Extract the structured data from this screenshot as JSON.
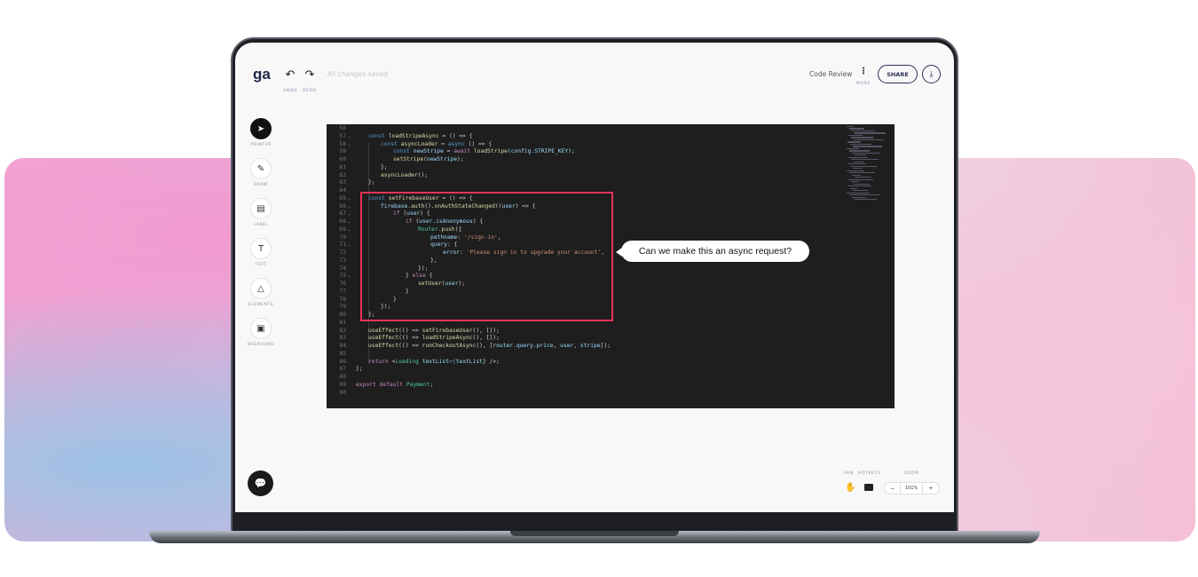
{
  "app": {
    "logo": "ga",
    "undo": "UNDO",
    "redo": "REDO",
    "status": "All changes saved",
    "doc_title": "Code Review",
    "more": "MORE",
    "share": "SHARE"
  },
  "tools": [
    {
      "label": "POINTER",
      "icon": "➤"
    },
    {
      "label": "DRAW",
      "icon": "✎"
    },
    {
      "label": "LABEL",
      "icon": "▤"
    },
    {
      "label": "TEXT",
      "icon": "T"
    },
    {
      "label": "ELEMENTS",
      "icon": "△"
    },
    {
      "label": "BKGROUND",
      "icon": "▣"
    }
  ],
  "bottom": {
    "pan": "PAN",
    "hotkeys": "HOTKEYS",
    "zoom_label": "ZOOM",
    "zoom_value": "101%",
    "minus": "−",
    "plus": "+"
  },
  "comment": "Can we make this an async request?",
  "colors": {
    "highlight": "#e8335a",
    "editor_bg": "#1e1e1e"
  },
  "code": [
    {
      "n": "56",
      "i": 0,
      "f": false,
      "t": []
    },
    {
      "n": "57",
      "i": 1,
      "f": true,
      "t": [
        [
          "const ",
          "k"
        ],
        [
          "loadStripeAsync",
          "fn"
        ],
        [
          " = () => {",
          "d"
        ]
      ]
    },
    {
      "n": "58",
      "i": 2,
      "f": true,
      "t": [
        [
          "const ",
          "k"
        ],
        [
          "asyncLoader",
          "fn"
        ],
        [
          " = ",
          "d"
        ],
        [
          "async",
          "k"
        ],
        [
          " () => {",
          "d"
        ]
      ]
    },
    {
      "n": "59",
      "i": 3,
      "f": false,
      "t": [
        [
          "const ",
          "k"
        ],
        [
          "newStripe",
          "v"
        ],
        [
          " = ",
          "d"
        ],
        [
          "await ",
          "p"
        ],
        [
          "loadStripe",
          "fn"
        ],
        [
          "(config.STRIPE_KEY);",
          "v"
        ]
      ]
    },
    {
      "n": "60",
      "i": 3,
      "f": false,
      "t": [
        [
          "setStripe",
          "fn"
        ],
        [
          "(",
          "d"
        ],
        [
          "newStripe",
          "v"
        ],
        [
          ");",
          "d"
        ]
      ]
    },
    {
      "n": "61",
      "i": 2,
      "f": false,
      "t": [
        [
          "};",
          "d"
        ]
      ]
    },
    {
      "n": "62",
      "i": 2,
      "f": false,
      "t": [
        [
          "asyncLoader",
          "fn"
        ],
        [
          "();",
          "d"
        ]
      ]
    },
    {
      "n": "63",
      "i": 1,
      "f": false,
      "t": [
        [
          "};",
          "d"
        ]
      ]
    },
    {
      "n": "64",
      "i": 0,
      "f": false,
      "t": []
    },
    {
      "n": "65",
      "i": 1,
      "f": true,
      "t": [
        [
          "const ",
          "k"
        ],
        [
          "setFirebaseUser",
          "fn"
        ],
        [
          " = () => {",
          "d"
        ]
      ]
    },
    {
      "n": "66",
      "i": 2,
      "f": true,
      "t": [
        [
          "firebase",
          "v"
        ],
        [
          ".",
          "d"
        ],
        [
          "auth",
          "fn"
        ],
        [
          "().",
          "d"
        ],
        [
          "onAuthStateChanged",
          "fn"
        ],
        [
          "((",
          "d"
        ],
        [
          "user",
          "v"
        ],
        [
          ") => {",
          "d"
        ]
      ]
    },
    {
      "n": "67",
      "i": 3,
      "f": true,
      "t": [
        [
          "if ",
          "p"
        ],
        [
          "(",
          "d"
        ],
        [
          "user",
          "v"
        ],
        [
          ") {",
          "d"
        ]
      ]
    },
    {
      "n": "68",
      "i": 4,
      "f": true,
      "t": [
        [
          "if ",
          "p"
        ],
        [
          "(",
          "d"
        ],
        [
          "user.isAnonymous",
          "v"
        ],
        [
          ") {",
          "d"
        ]
      ]
    },
    {
      "n": "69",
      "i": 5,
      "f": true,
      "t": [
        [
          "Router",
          "g"
        ],
        [
          ".",
          "d"
        ],
        [
          "push",
          "fn"
        ],
        [
          "({",
          "d"
        ]
      ]
    },
    {
      "n": "70",
      "i": 6,
      "f": false,
      "t": [
        [
          "pathname",
          "v"
        ],
        [
          ": ",
          "d"
        ],
        [
          "'/sign-in'",
          "s"
        ],
        [
          ",",
          "d"
        ]
      ]
    },
    {
      "n": "71",
      "i": 6,
      "f": true,
      "t": [
        [
          "query",
          "v"
        ],
        [
          ": {",
          "d"
        ]
      ]
    },
    {
      "n": "72",
      "i": 7,
      "f": false,
      "t": [
        [
          "error",
          "v"
        ],
        [
          ": ",
          "d"
        ],
        [
          "'Please sign in to upgrade your account'",
          "s"
        ],
        [
          ",",
          "d"
        ]
      ]
    },
    {
      "n": "73",
      "i": 6,
      "f": false,
      "t": [
        [
          "},",
          "d"
        ]
      ]
    },
    {
      "n": "74",
      "i": 5,
      "f": false,
      "t": [
        [
          "});",
          "d"
        ]
      ]
    },
    {
      "n": "75",
      "i": 4,
      "f": true,
      "t": [
        [
          "} ",
          "d"
        ],
        [
          "else",
          "p"
        ],
        [
          " {",
          "d"
        ]
      ]
    },
    {
      "n": "76",
      "i": 5,
      "f": false,
      "t": [
        [
          "setUser",
          "fn"
        ],
        [
          "(",
          "d"
        ],
        [
          "user",
          "v"
        ],
        [
          ");",
          "d"
        ]
      ]
    },
    {
      "n": "77",
      "i": 4,
      "f": false,
      "t": [
        [
          "}",
          "d"
        ]
      ]
    },
    {
      "n": "78",
      "i": 3,
      "f": false,
      "t": [
        [
          "}",
          "d"
        ]
      ]
    },
    {
      "n": "79",
      "i": 2,
      "f": false,
      "t": [
        [
          "});",
          "d"
        ]
      ]
    },
    {
      "n": "80",
      "i": 1,
      "f": false,
      "t": [
        [
          "};",
          "d"
        ]
      ]
    },
    {
      "n": "81",
      "i": 0,
      "f": false,
      "t": []
    },
    {
      "n": "82",
      "i": 1,
      "f": false,
      "t": [
        [
          "useEffect",
          "fn"
        ],
        [
          "(() => ",
          "d"
        ],
        [
          "setFirebaseUser",
          "fn"
        ],
        [
          "(), []);",
          "d"
        ]
      ]
    },
    {
      "n": "83",
      "i": 1,
      "f": false,
      "t": [
        [
          "useEffect",
          "fn"
        ],
        [
          "(() => ",
          "d"
        ],
        [
          "loadStripeAsync",
          "fn"
        ],
        [
          "(), []);",
          "d"
        ]
      ]
    },
    {
      "n": "84",
      "i": 1,
      "f": false,
      "t": [
        [
          "useEffect",
          "fn"
        ],
        [
          "(() => ",
          "d"
        ],
        [
          "runCheckoutAsync",
          "fn"
        ],
        [
          "(), [",
          "d"
        ],
        [
          "router.query.price",
          "v"
        ],
        [
          ", ",
          "d"
        ],
        [
          "user",
          "v"
        ],
        [
          ", ",
          "d"
        ],
        [
          "stripe",
          "v"
        ],
        [
          "]);",
          "d"
        ]
      ]
    },
    {
      "n": "85",
      "i": 0,
      "f": false,
      "t": []
    },
    {
      "n": "86",
      "i": 1,
      "f": false,
      "t": [
        [
          "return ",
          "p"
        ],
        [
          "<",
          "d"
        ],
        [
          "Loading ",
          "g"
        ],
        [
          "textList",
          "v"
        ],
        [
          "={",
          "k"
        ],
        [
          "textList",
          "v"
        ],
        [
          "} />;",
          "d"
        ]
      ]
    },
    {
      "n": "87",
      "i": 0,
      "f": false,
      "t": [
        [
          "};",
          "d"
        ]
      ]
    },
    {
      "n": "88",
      "i": 0,
      "f": false,
      "t": []
    },
    {
      "n": "89",
      "i": 0,
      "f": false,
      "t": [
        [
          "export ",
          "p"
        ],
        [
          "default ",
          "p"
        ],
        [
          "Payment",
          "g"
        ],
        [
          ";",
          "d"
        ]
      ]
    },
    {
      "n": "90",
      "i": 0,
      "f": false,
      "t": []
    }
  ]
}
